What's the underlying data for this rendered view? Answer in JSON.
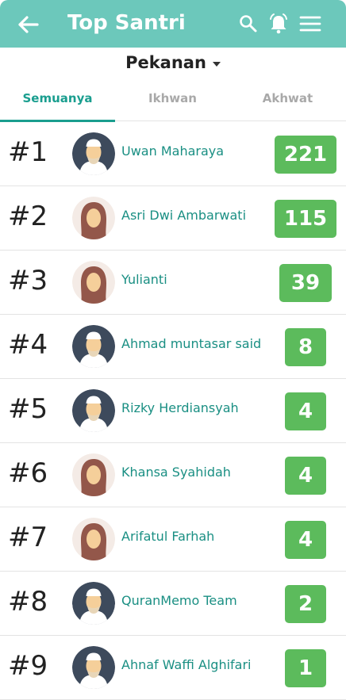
{
  "appbar": {
    "title": "Top Santri"
  },
  "period": {
    "label": "Pekanan"
  },
  "tabs": [
    {
      "label": "Semuanya"
    },
    {
      "label": "Ikhwan"
    },
    {
      "label": "Akhwat"
    }
  ],
  "colors": {
    "appbar": "#6cc8bb",
    "accent": "#1a9e8f",
    "score_badge": "#5cbb5c"
  },
  "leaderboard": [
    {
      "rank": "#1",
      "name": "Uwan Maharaya",
      "score": "221",
      "avatar": "male-avatar-icon"
    },
    {
      "rank": "#2",
      "name": "Asri Dwi Ambarwati",
      "score": "115",
      "avatar": "female-avatar-icon"
    },
    {
      "rank": "#3",
      "name": "Yulianti",
      "score": "39",
      "avatar": "female-avatar-icon"
    },
    {
      "rank": "#4",
      "name": "Ahmad muntasar said",
      "score": "8",
      "avatar": "male-avatar-icon"
    },
    {
      "rank": "#5",
      "name": "Rizky Herdiansyah",
      "score": "4",
      "avatar": "male-avatar-icon"
    },
    {
      "rank": "#6",
      "name": "Khansa Syahidah",
      "score": "4",
      "avatar": "female-avatar-icon"
    },
    {
      "rank": "#7",
      "name": "Arifatul Farhah",
      "score": "4",
      "avatar": "female-avatar-icon"
    },
    {
      "rank": "#8",
      "name": "QuranMemo Team",
      "score": "2",
      "avatar": "male-avatar-icon"
    },
    {
      "rank": "#9",
      "name": "Ahnaf Waffi Alghifari",
      "score": "1",
      "avatar": "male-avatar-icon"
    }
  ]
}
